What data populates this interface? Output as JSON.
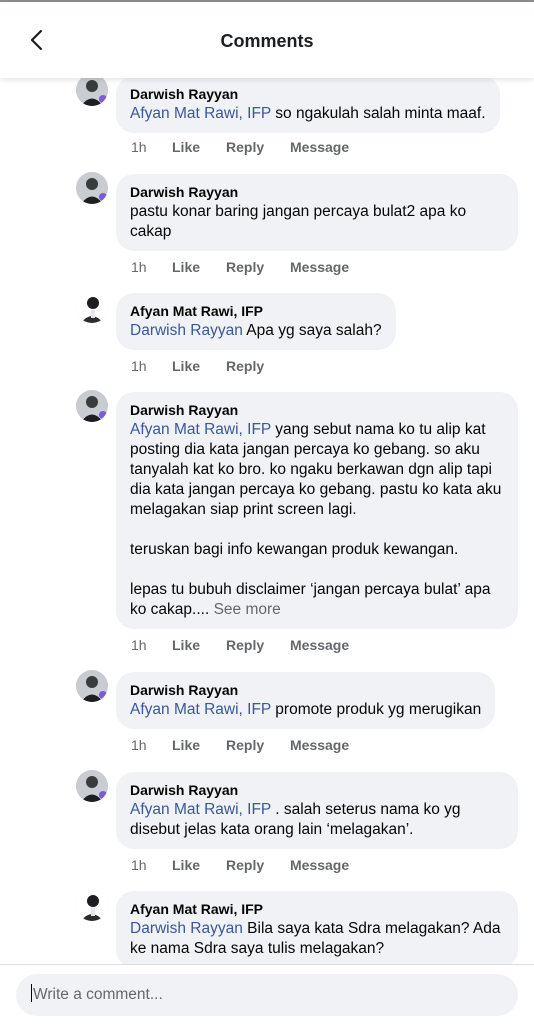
{
  "header": {
    "title": "Comments"
  },
  "comments": [
    {
      "author": "Darwish Rayyan",
      "avatar": "avatar-darwish",
      "mention": "Afyan Mat Rawi, IFP",
      "text": " so ngakulah salah minta maaf.",
      "time": "1h",
      "like": "Like",
      "reply": "Reply",
      "message": "Message"
    },
    {
      "author": "Darwish Rayyan",
      "avatar": "avatar-darwish",
      "text": "pastu konar baring jangan percaya bulat2 apa ko cakap",
      "time": "1h",
      "like": "Like",
      "reply": "Reply",
      "message": "Message"
    },
    {
      "author": "Afyan Mat Rawi, IFP",
      "avatar": "avatar-afyan",
      "mention": "Darwish Rayyan",
      "text": " Apa yg saya salah?",
      "time": "1h",
      "like": "Like",
      "reply": "Reply"
    },
    {
      "author": "Darwish Rayyan",
      "avatar": "avatar-darwish",
      "mention": "Afyan Mat Rawi, IFP",
      "text": " yang sebut nama ko tu alip kat posting dia kata jangan percaya ko gebang. so aku tanyalah kat ko bro. ko ngaku berkawan dgn alip tapi dia kata jangan percaya ko gebang. pastu ko kata aku melagakan siap print screen lagi.",
      "para2": "teruskan bagi info kewangan produk kewangan.",
      "para3": "lepas tu bubuh disclaimer ‘jangan percaya bulat’ apa ko cakap.... ",
      "see_more": "See more",
      "time": "1h",
      "like": "Like",
      "reply": "Reply",
      "message": "Message"
    },
    {
      "author": "Darwish Rayyan",
      "avatar": "avatar-darwish",
      "mention": "Afyan Mat Rawi, IFP",
      "text": " promote produk yg merugikan",
      "time": "1h",
      "like": "Like",
      "reply": "Reply",
      "message": "Message"
    },
    {
      "author": "Darwish Rayyan",
      "avatar": "avatar-darwish",
      "mention": "Afyan Mat Rawi, IFP",
      "text": " . salah seterus nama ko yg disebut jelas kata orang lain ‘melagakan’.",
      "time": "1h",
      "like": "Like",
      "reply": "Reply",
      "message": "Message"
    },
    {
      "author": "Afyan Mat Rawi, IFP",
      "avatar": "avatar-afyan",
      "mention": "Darwish Rayyan",
      "text": " Bila saya kata Sdra melagakan? Ada ke nama Sdra saya tulis melagakan?"
    }
  ],
  "composer": {
    "placeholder": "Write a comment..."
  },
  "colors": {
    "mention": "#385898",
    "bubble": "#f0f2f5",
    "meta": "#65676b"
  }
}
